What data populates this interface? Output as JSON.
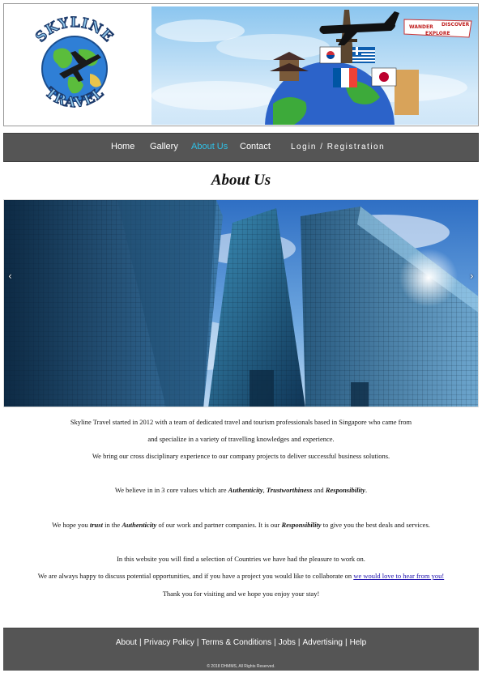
{
  "brand": {
    "logo_text_top": "SKYLINE",
    "logo_text_bottom": "TRAVEL",
    "banner_words": [
      "WANDER",
      "DISCOVER",
      "EXPLORE"
    ]
  },
  "nav": {
    "items": [
      {
        "label": "Home",
        "active": false
      },
      {
        "label": "Gallery",
        "active": false
      },
      {
        "label": "About Us",
        "active": true
      },
      {
        "label": "Contact",
        "active": false
      }
    ],
    "login_label": "Login / Registration"
  },
  "page": {
    "title": "About Us"
  },
  "carousel": {
    "prev_icon": "‹",
    "next_icon": "›"
  },
  "content": {
    "p1_line1": "Skyline Travel started in 2012 with a team of dedicated travel and tourism professionals based in Singapore who came from",
    "p1_line2": "and specialize in a variety of travelling knowledges and experience.",
    "p2": "We bring our cross disciplinary experience to our company projects to deliver successful business solutions.",
    "p3_a": "We believe in in 3 core values which are ",
    "p3_v1": "Authenticity",
    "p3_b": ", ",
    "p3_v2": "Trustworthiness",
    "p3_c": " and ",
    "p3_v3": "Responsibility",
    "p3_d": ".",
    "p4_a": "We hope you ",
    "p4_v1": "trust",
    "p4_b": " in the ",
    "p4_v2": "Authenticity",
    "p4_c": " of our work and partner companies. It is our ",
    "p4_v3": "Responsibility",
    "p4_d": " to give you the best deals and services.",
    "p5": "In this website you will find a selection of Countries we have had the pleasure to work on.",
    "p6_a": "We are always happy to discuss potential opportunities, and if you have a project you would like to collaborate on ",
    "p6_link": "we would love to hear from you!",
    "p7": "Thank you for visiting and we hope you enjoy your stay!"
  },
  "footer": {
    "links": [
      "About",
      "Privacy Policy",
      "Terms & Conditions",
      "Jobs",
      "Advertising",
      "Help"
    ],
    "separator": "|",
    "copyright": "© 2018 DHMMS, All Rights Reserved."
  },
  "colors": {
    "nav_bg": "#555555",
    "nav_active": "#2fc2e8",
    "link": "#1a0dab"
  }
}
